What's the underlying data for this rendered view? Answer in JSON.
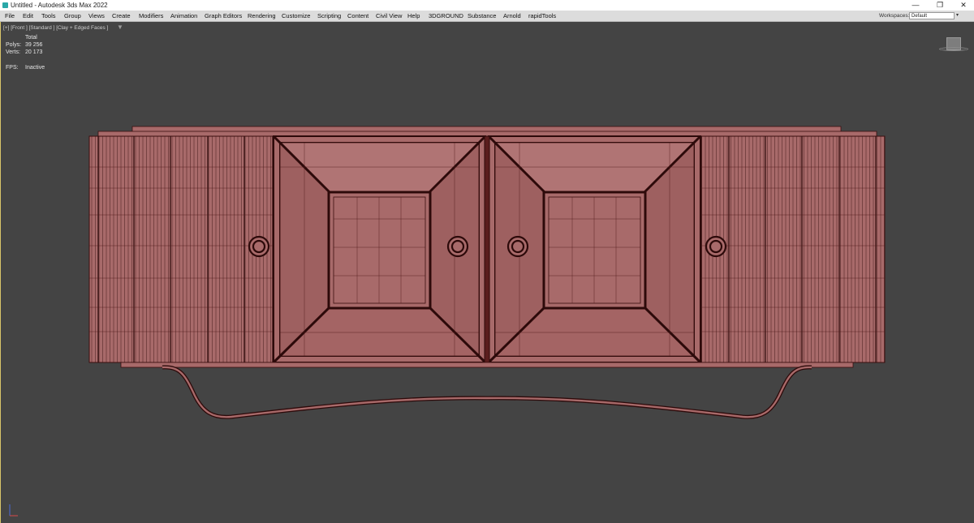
{
  "titlebar": {
    "title": "Untitled - Autodesk 3ds Max 2022",
    "minimize_glyph": "—",
    "maximize_glyph": "❐",
    "close_glyph": "✕"
  },
  "menu": {
    "items": [
      "File",
      "Edit",
      "Tools",
      "Group",
      "Views",
      "Create",
      "Modifiers",
      "Animation",
      "Graph Editors",
      "Rendering",
      "Customize",
      "Scripting",
      "Content",
      "Civil View",
      "Help",
      "3DGROUND",
      "Substance",
      "Arnold",
      "rapidTools"
    ],
    "workspaces_label": "Workspaces:",
    "workspace_value": "Default"
  },
  "viewport": {
    "label": "[+] [Front ] [Standard ] [Clay + Edged Faces ]",
    "filter_glyph": "▼",
    "stats": {
      "header": "Total",
      "polys_label": "Polys:",
      "polys_value": "39 256",
      "verts_label": "Verts:",
      "verts_value": "20 173",
      "fps_label": "FPS:",
      "fps_value": "Inactive"
    }
  },
  "colors": {
    "viewport_bg": "#444444",
    "model_fill": "#a86a6a",
    "model_wire": "#3a0e0e",
    "active_border": "#d8c56a"
  },
  "icons": [
    "app-icon",
    "viewcube-icon",
    "axis-gizmo-icon",
    "filter-dropdown-icon"
  ]
}
